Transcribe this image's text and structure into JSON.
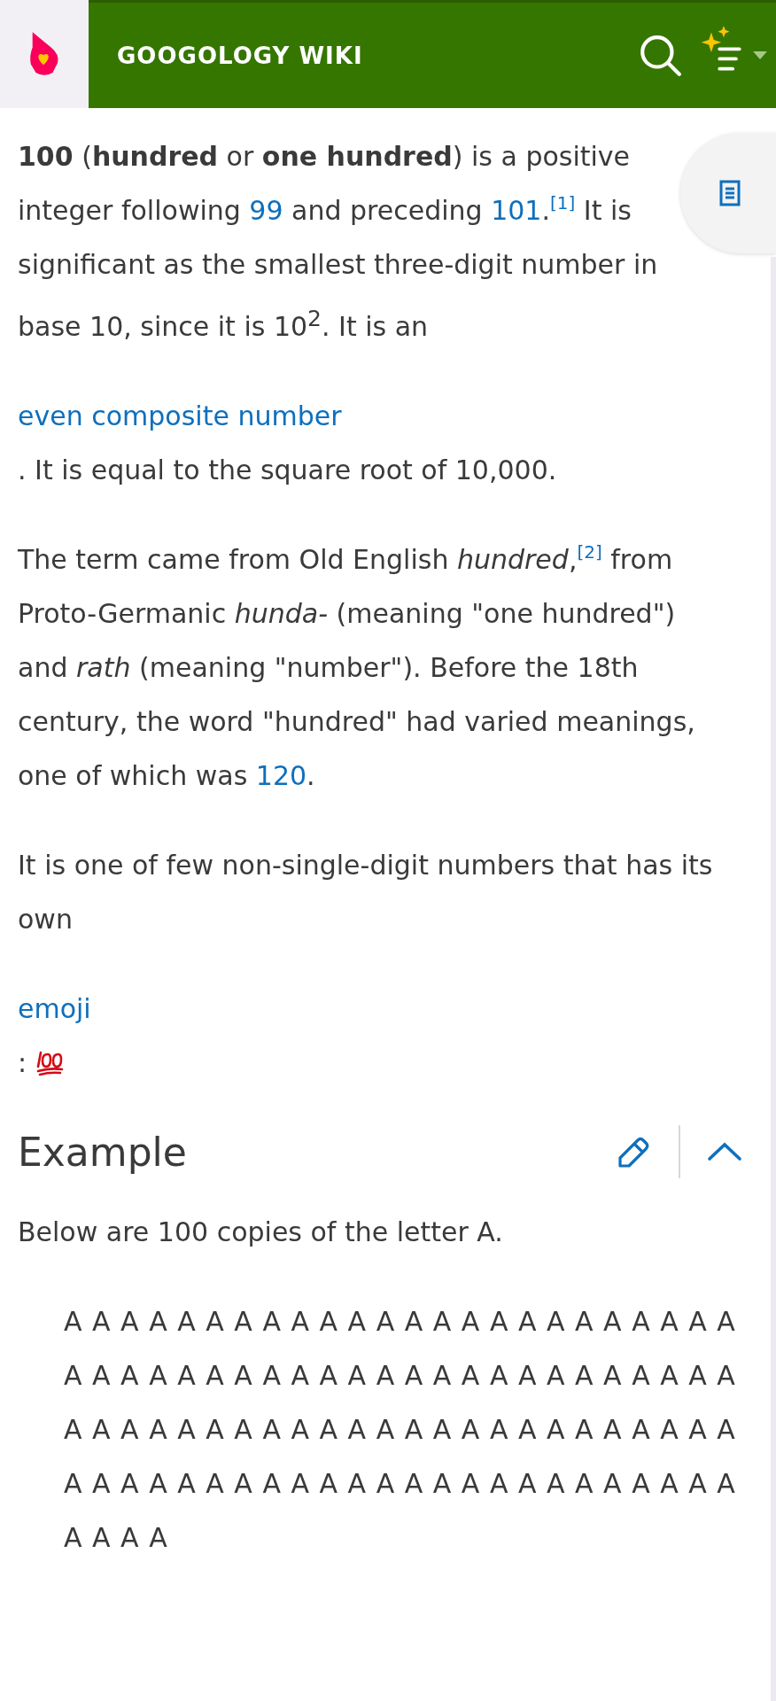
{
  "header": {
    "title": "GOOGOLOGY WIKI"
  },
  "intro": [
    [
      {
        "kind": "text",
        "text": "**100** (**hundred** or **one hundred**) is a positive integer following "
      },
      {
        "kind": "link",
        "text": "99"
      },
      {
        "kind": "text",
        "text": " and preceding "
      },
      {
        "kind": "link",
        "text": "101"
      },
      {
        "kind": "text",
        "text": "."
      },
      {
        "kind": "ref",
        "text": "[1]"
      },
      {
        "kind": "text",
        "text": " It is significant as the smallest three-digit number in base 10, since it is 10$^{2}$. It is an"
      }
    ],
    [
      {
        "kind": "block-link",
        "text": "even composite number"
      }
    ],
    [
      {
        "kind": "text",
        "text": ". It is equal to the square root of 10,000."
      }
    ],
    [
      {
        "kind": "text",
        "text": "The term came from Old English *hundred*,"
      },
      {
        "kind": "ref",
        "text": "[2]"
      },
      {
        "kind": "text",
        "text": " from Proto-Germanic *hunda-* (meaning \"one hundred\") and *rath* (meaning \"number\"). Before the 18th century, the word \"hundred\" had varied meanings, one of which was "
      },
      {
        "kind": "link",
        "text": "120"
      },
      {
        "kind": "text",
        "text": "."
      }
    ],
    [
      {
        "kind": "text",
        "text": "It is one of few non-single-digit numbers that has its own"
      }
    ],
    [
      {
        "kind": "block-link",
        "text": "emoji"
      }
    ],
    [
      {
        "kind": "text",
        "text": ":"
      },
      {
        "kind": "emoji"
      }
    ]
  ],
  "section": {
    "heading": "Example",
    "expanded": true,
    "text": "Below are 100 copies of the letter A.",
    "lines": [
      "A A A A A A A A A A A A A A A A A A A A A A A A",
      "A A A A A A A A A A A A A A A A A A A A A A A A",
      "A A A A A A A A A A A A A A A A A A A A A A A A",
      "A A A A A A A A A A A A A A A A A A A A A A A A",
      "A A A A"
    ]
  }
}
